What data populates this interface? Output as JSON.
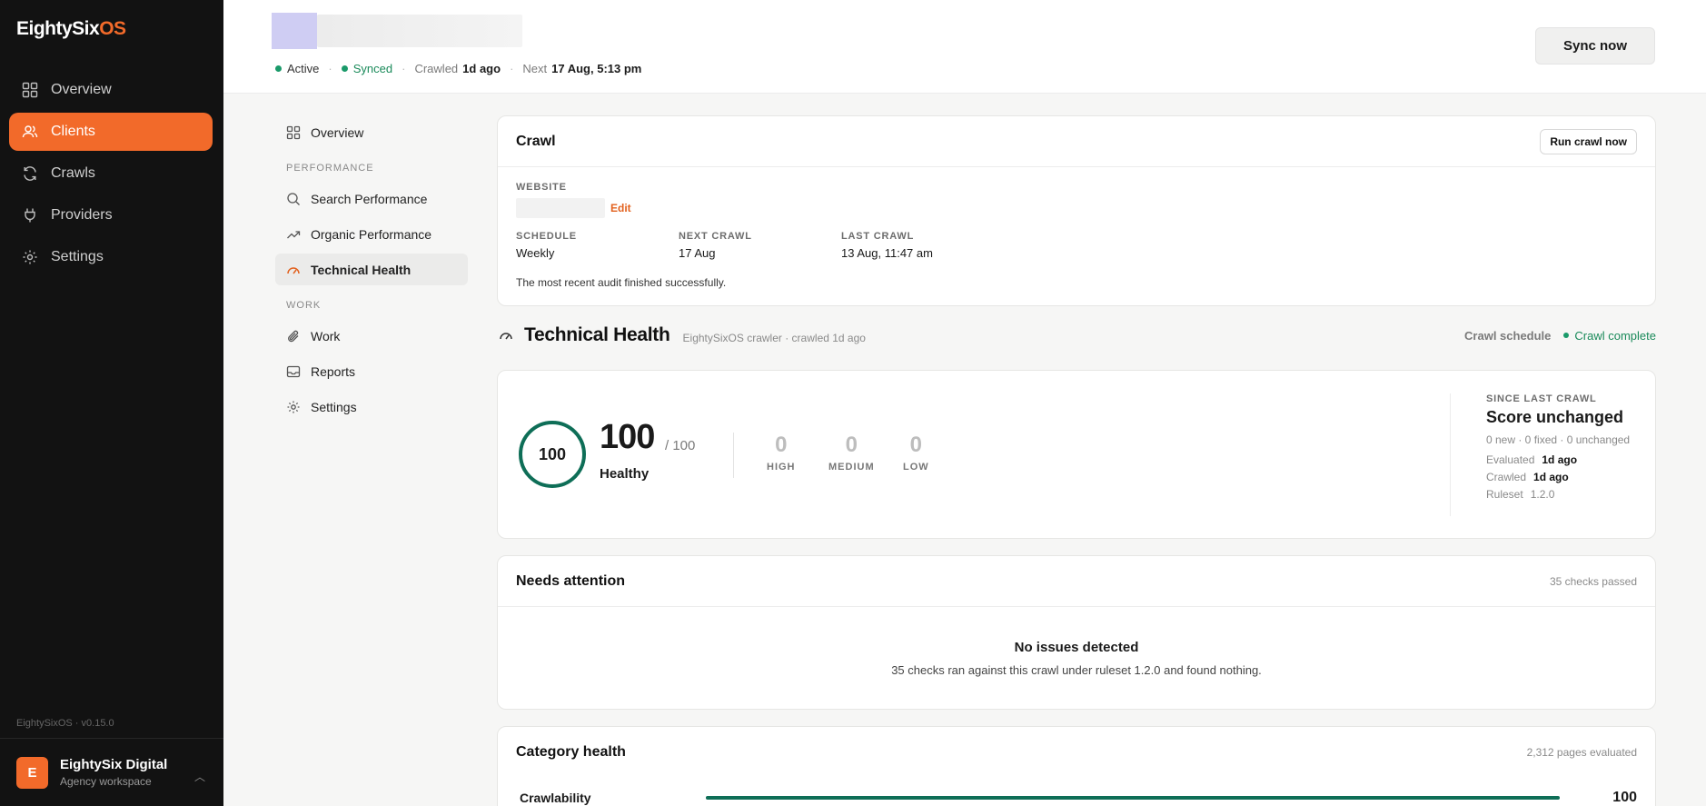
{
  "sidebar": {
    "brand_main": "EightySix",
    "brand_accent": "OS",
    "items": [
      {
        "label": "Overview",
        "icon": "grid-icon"
      },
      {
        "label": "Clients",
        "icon": "users-icon",
        "active": true
      },
      {
        "label": "Crawls",
        "icon": "refresh-icon"
      },
      {
        "label": "Providers",
        "icon": "plug-icon"
      },
      {
        "label": "Settings",
        "icon": "gear-icon"
      }
    ],
    "version": "EightySixOS · v0.15.0",
    "workspace": {
      "initial": "E",
      "name": "EightySix Digital",
      "subtitle": "Agency workspace"
    }
  },
  "header": {
    "status_active": "Active",
    "status_synced": "Synced",
    "crawled_label": "Crawled",
    "crawled_value": "1d ago",
    "next_label": "Next",
    "next_value": "17 Aug, 5:13 pm",
    "sync_button": "Sync now"
  },
  "subnav": {
    "overview": "Overview",
    "performance_section": "PERFORMANCE",
    "search_performance": "Search Performance",
    "organic_performance": "Organic Performance",
    "technical_health": "Technical Health",
    "work_section": "WORK",
    "work": "Work",
    "reports": "Reports",
    "settings": "Settings"
  },
  "crawl": {
    "title": "Crawl",
    "run_button": "Run crawl now",
    "website_label": "WEBSITE",
    "edit_link": "Edit",
    "schedule_label": "SCHEDULE",
    "schedule_value": "Weekly",
    "next_label": "NEXT CRAWL",
    "next_value": "17 Aug",
    "last_label": "LAST CRAWL",
    "last_value": "13 Aug, 11:47 am",
    "note": "The most recent audit finished successfully."
  },
  "technical_health": {
    "title": "Technical Health",
    "subtitle": "EightySixOS crawler · crawled 1d ago",
    "schedule_link": "Crawl schedule",
    "status": "Crawl complete",
    "score": "100",
    "score_big": "100",
    "out_of": "/ 100",
    "rating": "Healthy",
    "high_count": "0",
    "high_label": "HIGH",
    "medium_count": "0",
    "medium_label": "MEDIUM",
    "low_count": "0",
    "low_label": "LOW",
    "since_label": "SINCE LAST CRAWL",
    "since_head": "Score unchanged",
    "since_sub": "0 new · 0 fixed · 0 unchanged",
    "evaluated_label": "Evaluated",
    "evaluated_value": "1d ago",
    "crawled_label": "Crawled",
    "crawled_value": "1d ago",
    "ruleset_label": "Ruleset",
    "ruleset_value": "1.2.0"
  },
  "attention": {
    "title": "Needs attention",
    "checks_passed": "35 checks passed",
    "empty_title": "No issues detected",
    "empty_sub": "35 checks ran against this crawl under ruleset 1.2.0 and found nothing."
  },
  "category": {
    "title": "Category health",
    "pages": "2,312 pages evaluated",
    "rows": [
      {
        "name": "Crawlability",
        "score": "100",
        "fraction": 1.0
      }
    ]
  },
  "colors": {
    "accent": "#f26a2a",
    "success": "#1a8a5a",
    "ring": "#0e6e57"
  }
}
